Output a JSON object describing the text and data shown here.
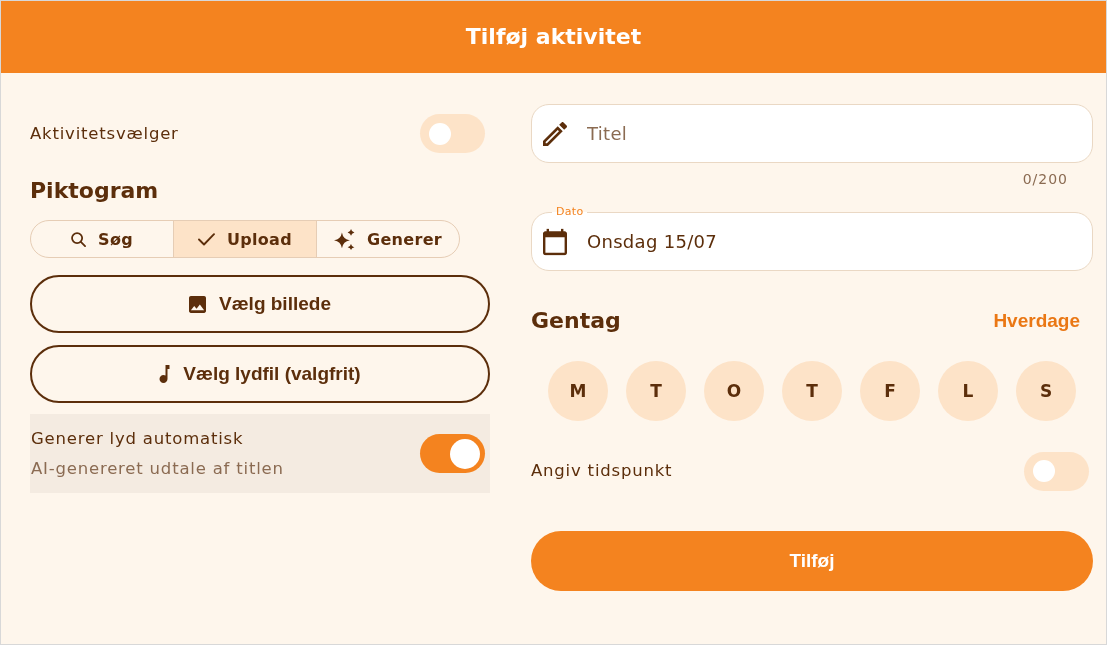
{
  "header": {
    "title": "Tilføj aktivitet"
  },
  "activity_picker": {
    "label": "Aktivitetsvælger",
    "on": false
  },
  "pictogram": {
    "heading": "Piktogram",
    "tabs": [
      {
        "label": "Søg",
        "kind": "search",
        "selected": false
      },
      {
        "label": "Upload",
        "kind": "upload",
        "selected": true
      },
      {
        "label": "Generer",
        "kind": "generate",
        "selected": false
      }
    ],
    "buttons": [
      {
        "label": "Vælg billede",
        "kind": "image"
      },
      {
        "label": "Vælg lydfil (valgfrit)",
        "kind": "audio"
      }
    ]
  },
  "auto_audio": {
    "label": "Generer lyd automatisk",
    "description": "AI-genereret udtale af titlen",
    "on": true
  },
  "title_field": {
    "placeholder": "Titel",
    "counter": "0/200"
  },
  "date_field": {
    "label": "Dato",
    "value": "Onsdag 15/07"
  },
  "repeat": {
    "heading": "Gentag",
    "preset": "Hverdage",
    "days": [
      {
        "label": "M",
        "selected": false
      },
      {
        "label": "T",
        "selected": false
      },
      {
        "label": "O",
        "selected": false
      },
      {
        "label": "T",
        "selected": false
      },
      {
        "label": "F",
        "selected": false
      },
      {
        "label": "L",
        "selected": false
      },
      {
        "label": "S",
        "selected": false
      }
    ]
  },
  "time_toggle": {
    "label": "Angiv tidspunkt",
    "on": false
  },
  "submit_button": {
    "label": "Tilføj"
  }
}
